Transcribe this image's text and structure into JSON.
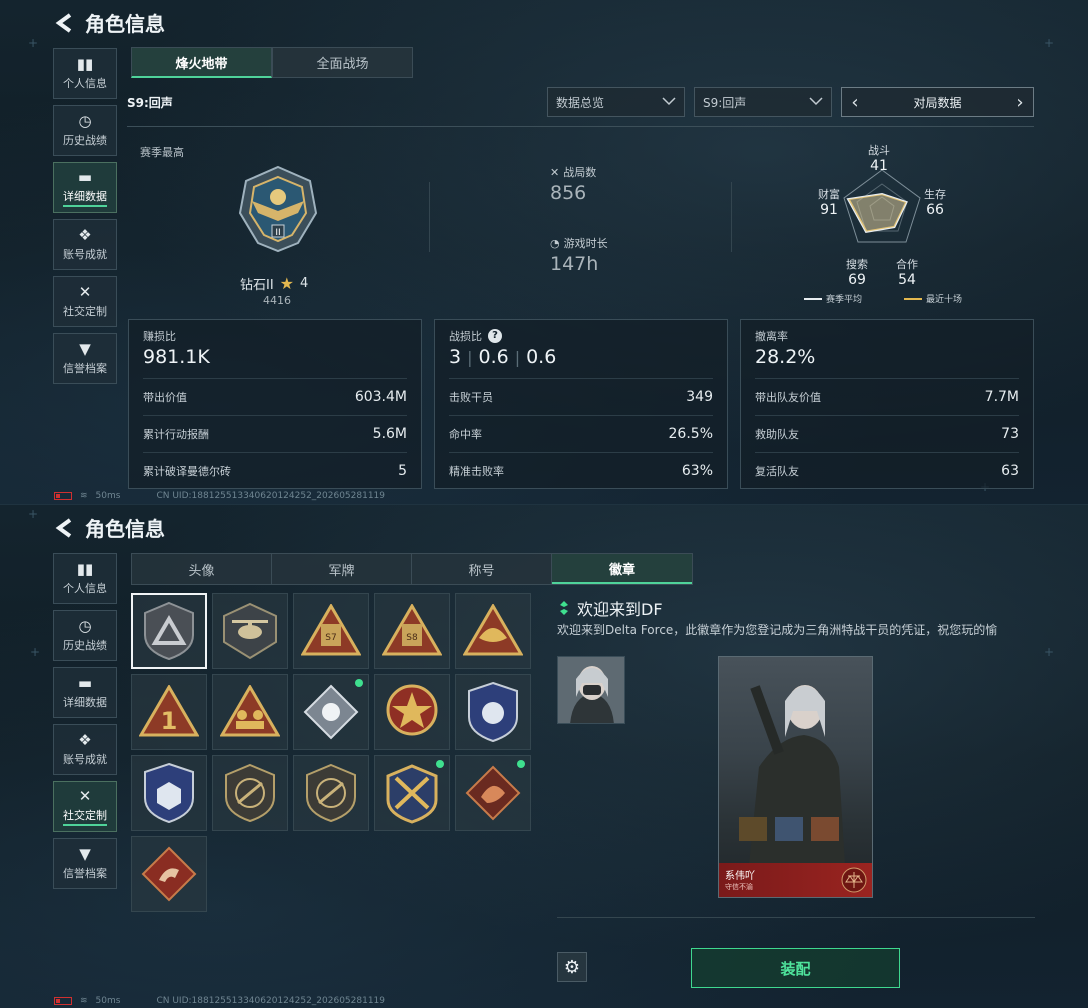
{
  "app_title": "角色信息",
  "sidebar": {
    "items": [
      {
        "label": "个人信息",
        "icon": "bar-chart-icon"
      },
      {
        "label": "历史战绩",
        "icon": "clock-icon"
      },
      {
        "label": "详细数据",
        "icon": "folder-icon"
      },
      {
        "label": "账号成就",
        "icon": "medal-icon"
      },
      {
        "label": "社交定制",
        "icon": "wrench-icon"
      },
      {
        "label": "信誉档案",
        "icon": "shield-check-icon"
      }
    ]
  },
  "top": {
    "mode_tabs": [
      "烽火地带",
      "全面战场"
    ],
    "season_label": "S9:回声",
    "dropdown_overview": "数据总览",
    "dropdown_season": "S9:回声",
    "pager_label": "对局数据",
    "rank": {
      "season_best_label": "赛季最高",
      "name": "钻石II",
      "stars": "4",
      "score": "4416"
    },
    "matches_label": "战局数",
    "matches_value": "856",
    "playtime_label": "游戏时长",
    "playtime_value": "147h",
    "radar": {
      "combat_label": "战斗",
      "combat_value": "41",
      "survival_label": "生存",
      "survival_value": "66",
      "coop_label": "合作",
      "coop_value": "54",
      "search_label": "搜索",
      "search_value": "69",
      "wealth_label": "财富",
      "wealth_value": "91",
      "legend_avg": "赛季平均",
      "legend_recent": "最近十场",
      "avg_color": "#e8edf0",
      "recent_color": "#e3b84f"
    },
    "card1": {
      "head_label": "赚损比",
      "head_value": "981.1K",
      "rows": [
        {
          "label": "带出价值",
          "value": "603.4M"
        },
        {
          "label": "累计行动报酬",
          "value": "5.6M"
        },
        {
          "label": "累计破译曼德尔砖",
          "value": "5"
        }
      ]
    },
    "card2": {
      "head_label": "战损比",
      "head_help": "?",
      "kd_values": [
        "3",
        "0.6",
        "0.6"
      ],
      "rows": [
        {
          "label": "击败干员",
          "value": "349"
        },
        {
          "label": "命中率",
          "value": "26.5%"
        },
        {
          "label": "精准击败率",
          "value": "63%"
        }
      ]
    },
    "card3": {
      "head_label": "撤离率",
      "head_value": "28.2%",
      "rows": [
        {
          "label": "带出队友价值",
          "value": "7.7M"
        },
        {
          "label": "救助队友",
          "value": "73"
        },
        {
          "label": "复活队友",
          "value": "63"
        }
      ]
    },
    "status": {
      "ping": "50ms",
      "uid": "CN UID:1881255133406201242​52_202605281119"
    }
  },
  "bottom": {
    "tabs": [
      "头像",
      "军牌",
      "称号",
      "徽章"
    ],
    "detail_title": "欢迎来到DF",
    "detail_desc": "欢迎来到Delta Force，此徽章作为您登记成为三角洲特战干员的凭证，祝您玩的愉",
    "card_name": "系伟吖",
    "card_sub": "守信不渝",
    "equip_label": "装配",
    "status": {
      "ping": "50ms",
      "uid": "CN UID:188125513340620124252_202605281119"
    }
  }
}
